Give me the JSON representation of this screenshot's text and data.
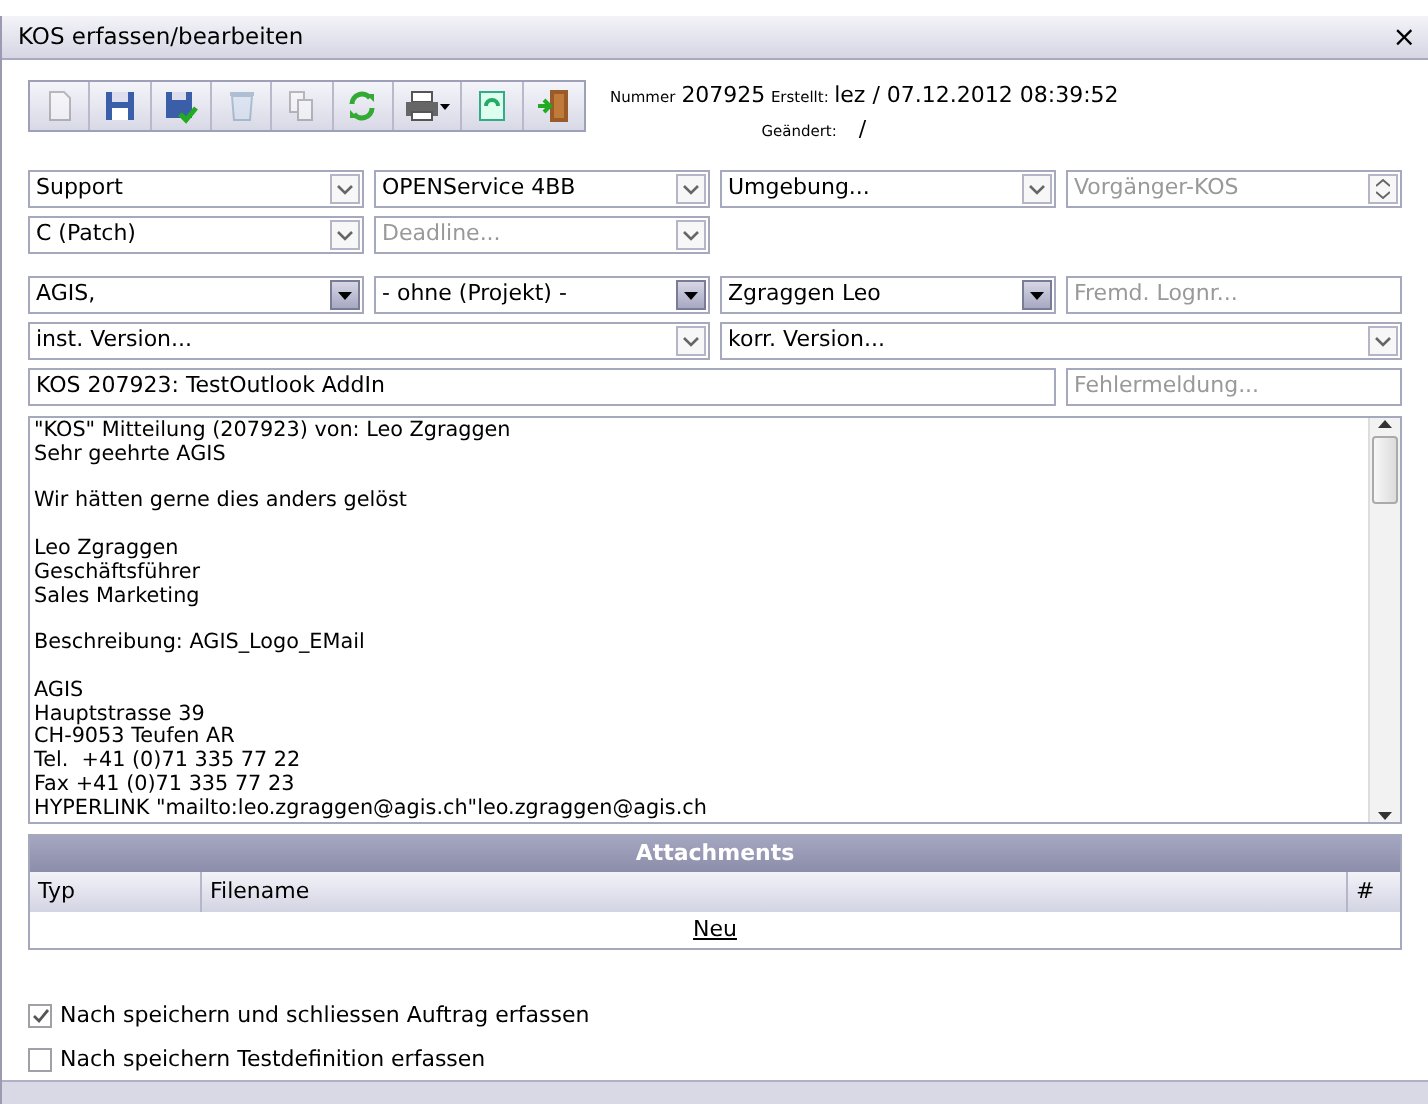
{
  "window": {
    "title": "KOS erfassen/bearbeiten",
    "close": "×"
  },
  "toolbar": [
    {
      "kind": "new",
      "disabled": true
    },
    {
      "kind": "save",
      "disabled": false
    },
    {
      "kind": "save-check",
      "disabled": false
    },
    {
      "kind": "delete",
      "disabled": true
    },
    {
      "kind": "copy",
      "disabled": true
    },
    {
      "kind": "refresh",
      "disabled": false
    },
    {
      "kind": "print",
      "disabled": false
    },
    {
      "kind": "reload",
      "disabled": false
    },
    {
      "kind": "exit",
      "disabled": false
    }
  ],
  "info": {
    "nummer_label": "Nummer",
    "nummer": "207925",
    "erstellt_label": "Erstellt:",
    "erstellt": "lez / 07.12.2012 08:39:52",
    "geaendert_label": "Geändert:",
    "geaendert": "/"
  },
  "form_rows": [
    [
      {
        "kind": "combo",
        "value": "Support"
      },
      {
        "kind": "combo",
        "value": "OPENService 4BB"
      },
      {
        "kind": "combo",
        "value": "Umgebung..."
      },
      {
        "kind": "spin",
        "placeholder": "Vorgänger-KOS"
      }
    ],
    [
      {
        "kind": "combo",
        "value": "C (Patch)"
      },
      {
        "kind": "combo",
        "placeholder": "Deadline..."
      }
    ],
    [
      {
        "kind": "lookup",
        "value": "AGIS,"
      },
      {
        "kind": "lookup",
        "value": "- ohne (Projekt) -"
      },
      {
        "kind": "lookup",
        "value": "Zgraggen Leo"
      },
      {
        "kind": "text",
        "placeholder": "Fremd. Lognr..."
      }
    ],
    [
      {
        "kind": "combo",
        "value": "inst. Version..."
      },
      {
        "kind": "combo",
        "value": "korr. Version..."
      }
    ],
    [
      {
        "kind": "text",
        "value": "KOS 207923: TestOutlook AddIn"
      },
      {
        "kind": "text",
        "placeholder": "Fehlermeldung..."
      }
    ]
  ],
  "memo": {
    "paragraphs": [
      [
        "\"KOS\" Mitteilung (207923) von: Leo Zgraggen",
        "Sehr geehrte AGIS"
      ],
      [
        "Wir hätten gerne dies anders gelöst"
      ],
      [
        "Leo Zgraggen",
        "Geschäftsführer",
        "Sales Marketing"
      ],
      [
        "Beschreibung: AGIS_Logo_EMail"
      ],
      [
        "AGIS",
        "Hauptstrasse 39",
        "CH-9053 Teufen AR",
        "Tel.  +41 (0)71 335 77 22",
        "Fax +41 (0)71 335 77 23",
        "HYPERLINK \"mailto:leo.zgraggen@agis.ch\"leo.zgraggen@agis.ch"
      ]
    ]
  },
  "attachments": {
    "title": "Attachments",
    "columns": [
      "Typ",
      "Filename",
      "#"
    ],
    "new_link": "Neu"
  },
  "options": [
    {
      "label": "Nach speichern und schliessen Auftrag erfassen",
      "checked": true
    },
    {
      "label": "Nach speichern Testdefinition erfassen",
      "checked": false
    }
  ]
}
